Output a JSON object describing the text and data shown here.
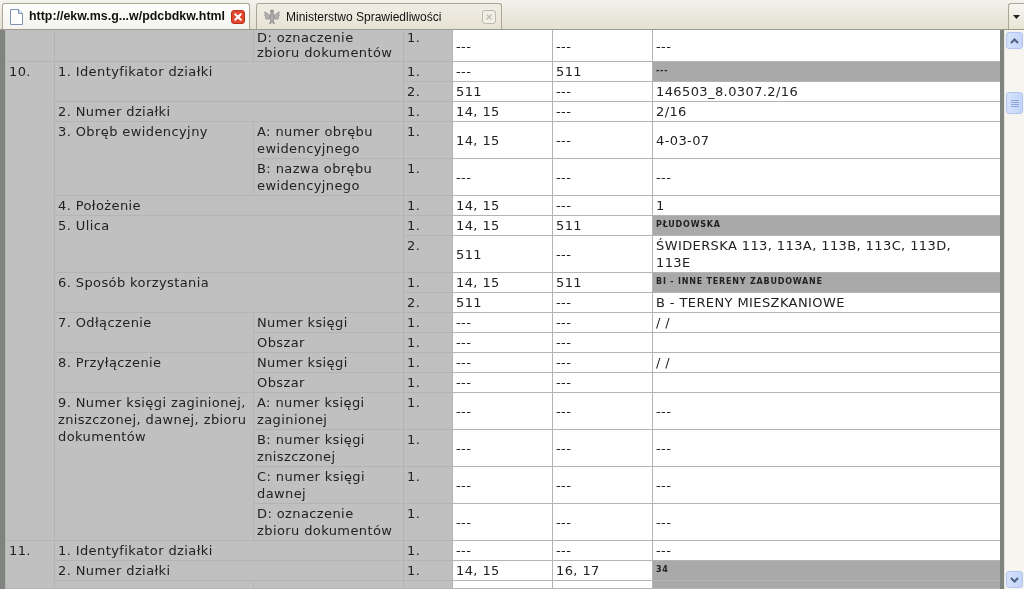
{
  "tabs": [
    {
      "label": "http://ekw.ms.g...w/pdcbdkw.html",
      "selected": true,
      "kind": "document"
    },
    {
      "label": "Ministerstwo Sprawiedliwości",
      "selected": false,
      "kind": "favicon"
    }
  ],
  "table": {
    "sections": [
      {
        "fields": [
          {
            "subfields": [
              {
                "label": "D: oznaczenie zbioru dokumentów",
                "entries": [
                  {
                    "index": "1.",
                    "column_5": "---",
                    "column_6": "---",
                    "column_7": "---",
                    "greyed": false
                  }
                ]
              }
            ]
          }
        ]
      },
      {
        "number": "10.",
        "fields": [
          {
            "label": "1. Identyfikator działki",
            "entries": [
              {
                "index": "1.",
                "column_5": "---",
                "column_6": "511",
                "column_7": "---",
                "greyed": true
              },
              {
                "index": "2.",
                "column_5": "511",
                "column_6": "---",
                "column_7": "146503_8.0307.2/16",
                "greyed": false
              }
            ]
          },
          {
            "label": "2. Numer działki",
            "entries": [
              {
                "index": "1.",
                "column_5": "14, 15",
                "column_6": "---",
                "column_7": "2/16",
                "greyed": false
              }
            ]
          },
          {
            "label": "3. Obręb ewidencyjny",
            "subfields": [
              {
                "label": "A: numer obrębu ewidencyjnego",
                "entries": [
                  {
                    "index": "1.",
                    "column_5": "14, 15",
                    "column_6": "---",
                    "column_7": "4-03-07",
                    "greyed": false
                  }
                ]
              },
              {
                "label": "B: nazwa obrębu ewidencyjnego",
                "entries": [
                  {
                    "index": "1.",
                    "column_5": "---",
                    "column_6": "---",
                    "column_7": "---",
                    "greyed": false
                  }
                ]
              }
            ]
          },
          {
            "label": "4. Położenie",
            "entries": [
              {
                "index": "1.",
                "column_5": "14, 15",
                "column_6": "---",
                "column_7": "1",
                "greyed": false
              }
            ]
          },
          {
            "label": "5. Ulica",
            "entries": [
              {
                "index": "1.",
                "column_5": "14, 15",
                "column_6": "511",
                "column_7": "PŁUDOWSKA",
                "greyed": true
              },
              {
                "index": "2.",
                "column_5": "511",
                "column_6": "---",
                "column_7": "ŚWIDERSKA 113, 113A, 113B, 113C, 113D, 113E",
                "greyed": false
              }
            ]
          },
          {
            "label": "6. Sposób korzystania",
            "entries": [
              {
                "index": "1.",
                "column_5": "14, 15",
                "column_6": "511",
                "column_7": "BI - INNE TERENY ZABUDOWANE",
                "greyed": true
              },
              {
                "index": "2.",
                "column_5": "511",
                "column_6": "---",
                "column_7": "B - TERENY MIESZKANIOWE",
                "greyed": false
              }
            ]
          },
          {
            "label": "7. Odłączenie",
            "subfields": [
              {
                "label": "Numer księgi",
                "entries": [
                  {
                    "index": "1.",
                    "column_5": "---",
                    "column_6": "---",
                    "column_7": "/ /",
                    "greyed": false
                  }
                ]
              },
              {
                "label": "Obszar",
                "entries": [
                  {
                    "index": "1.",
                    "column_5": "---",
                    "column_6": "---",
                    "greyed": false
                  }
                ]
              }
            ]
          },
          {
            "label": "8. Przyłączenie",
            "subfields": [
              {
                "label": "Numer księgi",
                "entries": [
                  {
                    "index": "1.",
                    "column_5": "---",
                    "column_6": "---",
                    "column_7": "/ /",
                    "greyed": false
                  }
                ]
              },
              {
                "label": "Obszar",
                "entries": [
                  {
                    "index": "1.",
                    "column_5": "---",
                    "column_6": "---",
                    "greyed": false
                  }
                ]
              }
            ]
          },
          {
            "label": "9. Numer księgi zaginionej, zniszczonej, dawnej, zbioru dokumentów",
            "subfields": [
              {
                "label": "A: numer księgi zaginionej",
                "entries": [
                  {
                    "index": "1.",
                    "column_5": "---",
                    "column_6": "---",
                    "column_7": "---",
                    "greyed": false
                  }
                ]
              },
              {
                "label": "B: numer księgi zniszczonej",
                "entries": [
                  {
                    "index": "1.",
                    "column_5": "---",
                    "column_6": "---",
                    "column_7": "---",
                    "greyed": false
                  }
                ]
              },
              {
                "label": "C: numer księgi dawnej",
                "entries": [
                  {
                    "index": "1.",
                    "column_5": "---",
                    "column_6": "---",
                    "column_7": "---",
                    "greyed": false
                  }
                ]
              },
              {
                "label": "D: oznaczenie zbioru dokumentów",
                "entries": [
                  {
                    "index": "1.",
                    "column_5": "---",
                    "column_6": "---",
                    "column_7": "---",
                    "greyed": false
                  }
                ]
              }
            ]
          }
        ]
      },
      {
        "number": "11.",
        "fields": [
          {
            "label": "1. Identyfikator działki",
            "entries": [
              {
                "index": "1.",
                "column_5": "---",
                "column_6": "---",
                "column_7": "---",
                "greyed": false
              }
            ]
          },
          {
            "label": "2. Numer działki",
            "entries": [
              {
                "index": "1.",
                "column_5": "14, 15",
                "column_6": "16, 17",
                "column_7": "34",
                "greyed": true
              }
            ]
          },
          {
            "subfields": [
              {
                "entries": [
                  {
                    "greyed": true
                  }
                ]
              }
            ]
          }
        ]
      }
    ]
  }
}
